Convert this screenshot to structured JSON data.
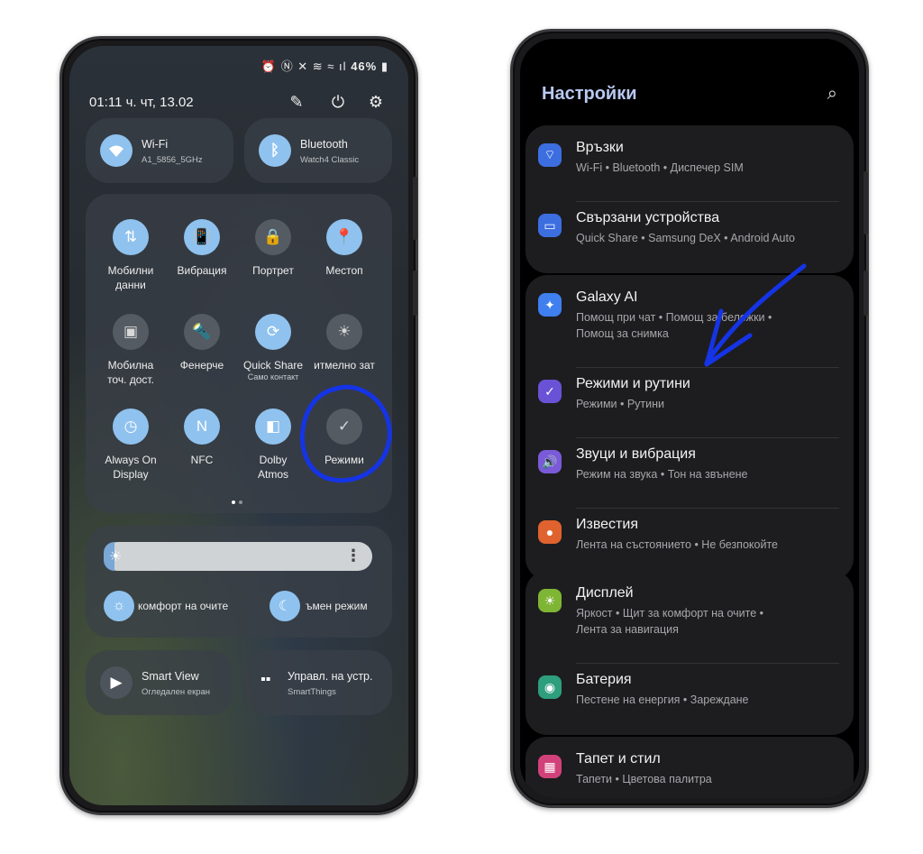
{
  "quick_panel": {
    "status_bar": {
      "icons": [
        "alarm-icon",
        "nfc-icon",
        "mute-icon",
        "vibrate-icon",
        "wifi-icon",
        "signal-icon"
      ],
      "battery": "46%"
    },
    "datetime": "01:11 ч.  чт, 13.02",
    "header_icons": [
      "edit-icon",
      "power-icon",
      "settings-icon"
    ],
    "wifi": {
      "title": "Wi-Fi",
      "subtitle": "A1_5856_5GHz"
    },
    "bluetooth": {
      "title": "Bluetooth",
      "subtitle": "Watch4 Classic"
    },
    "buttons": [
      {
        "label": "Мобилни\nданни",
        "icon": "data-arrows-icon",
        "on": true
      },
      {
        "label": "Вибрация",
        "icon": "vibrate-icon",
        "on": true
      },
      {
        "label": "Портрет",
        "icon": "lock-rotation-icon",
        "on": false
      },
      {
        "label": "Местоп",
        "icon": "location-icon",
        "on": true
      },
      {
        "label": "Мобилна\nточ. дост.",
        "icon": "hotspot-icon",
        "on": false
      },
      {
        "label": "Фенерче",
        "icon": "flashlight-icon",
        "on": false
      },
      {
        "label": "Quick Share",
        "sub": "Само контакт",
        "icon": "quick-share-icon",
        "on": true
      },
      {
        "label": "итмелно зат",
        "icon": "power-saving-icon",
        "on": false
      },
      {
        "label": "Always On\nDisplay",
        "icon": "always-on-display-icon",
        "on": true
      },
      {
        "label": "NFC",
        "icon": "nfc-icon",
        "on": true
      },
      {
        "label": "Dolby\nAtmos",
        "icon": "dolby-icon",
        "on": true
      },
      {
        "label": "Режими",
        "icon": "modes-check-icon",
        "on": false
      }
    ],
    "page_count": 2,
    "brightness": {
      "level": 0.04
    },
    "eye_comfort_label": "комфорт на очите",
    "dark_mode_label": "ъмен режим",
    "smart_view": {
      "title": "Smart View",
      "subtitle": "Огледален екран"
    },
    "device_control": {
      "title": "Управл. на устр.",
      "subtitle": "SmartThings"
    }
  },
  "settings": {
    "title": "Настройки",
    "groups": [
      [
        {
          "title": "Връзки",
          "subtitle": "Wi-Fi  •  Bluetooth  •  Диспечер SIM",
          "icon": "wifi-icon",
          "color": "#3d6ee0"
        },
        {
          "title": "Свързани устройства",
          "subtitle": "Quick Share  •  Samsung DeX  •  Android Auto",
          "icon": "devices-icon",
          "color": "#3d6ee0"
        }
      ],
      [
        {
          "title": "Galaxy AI",
          "subtitle": "Помощ при чат  •  Помощ за бележки  •\nПомощ за снимка",
          "icon": "sparkle-icon",
          "color": "#3f7ff0"
        },
        {
          "title": "Режими и рутини",
          "subtitle": "Режими  •  Рутини",
          "icon": "check-circle-icon",
          "color": "#6a52d6"
        },
        {
          "title": "Звуци и вибрация",
          "subtitle": "Режим на звука  •  Тон на звънене",
          "icon": "speaker-icon",
          "color": "#7a5ad8"
        },
        {
          "title": "Известия",
          "subtitle": "Лента на състоянието  •  Не безпокойте",
          "icon": "notification-icon",
          "color": "#e0622e"
        }
      ],
      [
        {
          "title": "Дисплей",
          "subtitle": "Яркост  •  Щит за комфорт на очите  •\nЛента за навигация",
          "icon": "sun-icon",
          "color": "#7fb534"
        },
        {
          "title": "Батерия",
          "subtitle": "Пестене на енергия  •  Зареждане",
          "icon": "battery-icon",
          "color": "#2e9e7c"
        }
      ],
      [
        {
          "title": "Тапет и стил",
          "subtitle": "Тапети  •  Цветова палитра",
          "icon": "wallpaper-icon",
          "color": "#d2427a"
        }
      ]
    ]
  },
  "annotation_color": "#1534e6"
}
